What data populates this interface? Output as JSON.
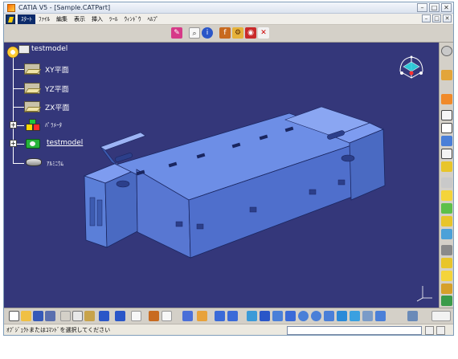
{
  "window": {
    "title": "CATIA V5 - [Sample.CATPart]",
    "controls": [
      "–",
      "□",
      "✕"
    ],
    "doc_controls": [
      "–",
      "□",
      "✕"
    ]
  },
  "menu": {
    "items": [
      "ｽﾀｰﾄ",
      "ﾌｧｲﾙ",
      "編集",
      "表示",
      "挿入",
      "ﾂｰﾙ",
      "ｳｨﾝﾄﾞｳ",
      "ﾍﾙﾌﾟ"
    ],
    "active_index": 0
  },
  "tree": {
    "root": "testmodel",
    "planes": [
      "XY平面",
      "YZ平面",
      "ZX平面"
    ],
    "parameters": "ﾊﾟﾗﾒｰﾀ",
    "part_body": "testmodel",
    "material": "ｱﾙﾐﾆｳﾑ"
  },
  "status": {
    "prompt": "ｵﾌﾞｼﾞｪｸﾄまたはｺﾏﾝﾄﾞを選択してください",
    "command_value": ""
  },
  "colors": {
    "viewport_bg": "#34377a",
    "model_fill": "#5b7fd8",
    "model_edge": "#1a2660",
    "model_light": "#7e9cf0",
    "model_dark": "#3d5bb0"
  },
  "toolbar_icons": {
    "top": [
      "sketcher-icon",
      "search-icon",
      "info-icon",
      "knowledge-icon",
      "formula-icon",
      "catalog-icon",
      "tool-icon"
    ],
    "right": [
      "sketch-icon",
      "pad-icon",
      "pocket-icon",
      "shaft-icon",
      "groove-icon",
      "hole-icon",
      "rib-icon",
      "slot-icon",
      "stiffener-icon",
      "fillet-icon",
      "chamfer-icon",
      "draft-icon",
      "shell-icon",
      "thickness-icon",
      "thread-icon",
      "solid-icon",
      "cube-icon",
      "measure-icon"
    ],
    "bottom": [
      "new-icon",
      "open-icon",
      "save-icon",
      "print-icon",
      "cut-icon",
      "copy-icon",
      "paste-icon",
      "undo-icon",
      "redo-icon",
      "whats-this-icon",
      "formula-icon",
      "comment-icon",
      "table-icon",
      "axis-icon",
      "select-icon",
      "hide-icon",
      "fly-icon",
      "fit-all-icon",
      "pan-icon",
      "rotate-icon",
      "zoom-in-icon",
      "zoom-out-icon",
      "normal-view-icon",
      "views-icon",
      "render-icon",
      "hide-show-icon",
      "swap-icon",
      "apply-material-icon",
      "catia-logo-icon"
    ]
  }
}
